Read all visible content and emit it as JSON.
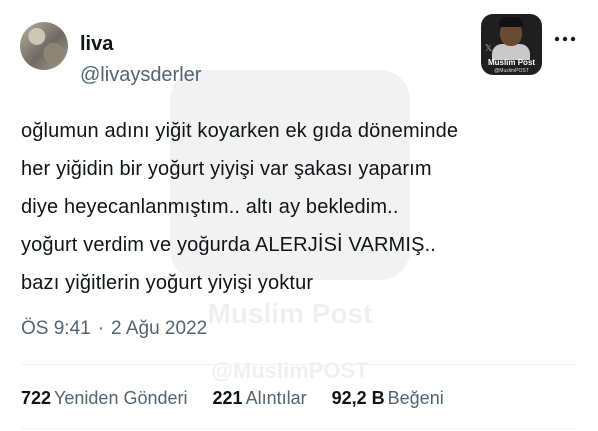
{
  "user": {
    "name": "liva",
    "handle": "@livaysderler"
  },
  "tweet": {
    "lines": [
      "oğlumun adını yiğit koyarken ek gıda döneminde",
      "her yiğidin bir yoğurt yiyişi var şakası yaparım",
      "diye heyecanlanmıştım.. altı ay bekledim..",
      "yoğurt verdim ve yoğurda ALERJİSİ VARMIŞ..",
      "bazı yiğitlerin yoğurt yiyişi yoktur"
    ],
    "time": "ÖS 9:41",
    "separator": "·",
    "date": "2 Ağu 2022"
  },
  "stats": {
    "retweets": {
      "value": "722",
      "label": "Yeniden Gönderi"
    },
    "quotes": {
      "value": "221",
      "label": "Alıntılar"
    },
    "likes": {
      "value": "92,2 B",
      "label": "Beğeni"
    }
  },
  "watermark": {
    "title": "Muslim Post",
    "subtitle": "@MuslimPOST",
    "big_title": "Muslim Post",
    "big_subtitle": "@MuslimPOST"
  },
  "icons": {
    "more": "more-horizontal-icon",
    "x_logo": "x-icon"
  },
  "colors": {
    "text": "#0f1419",
    "secondary": "#536471",
    "divider": "#eff3f4"
  }
}
